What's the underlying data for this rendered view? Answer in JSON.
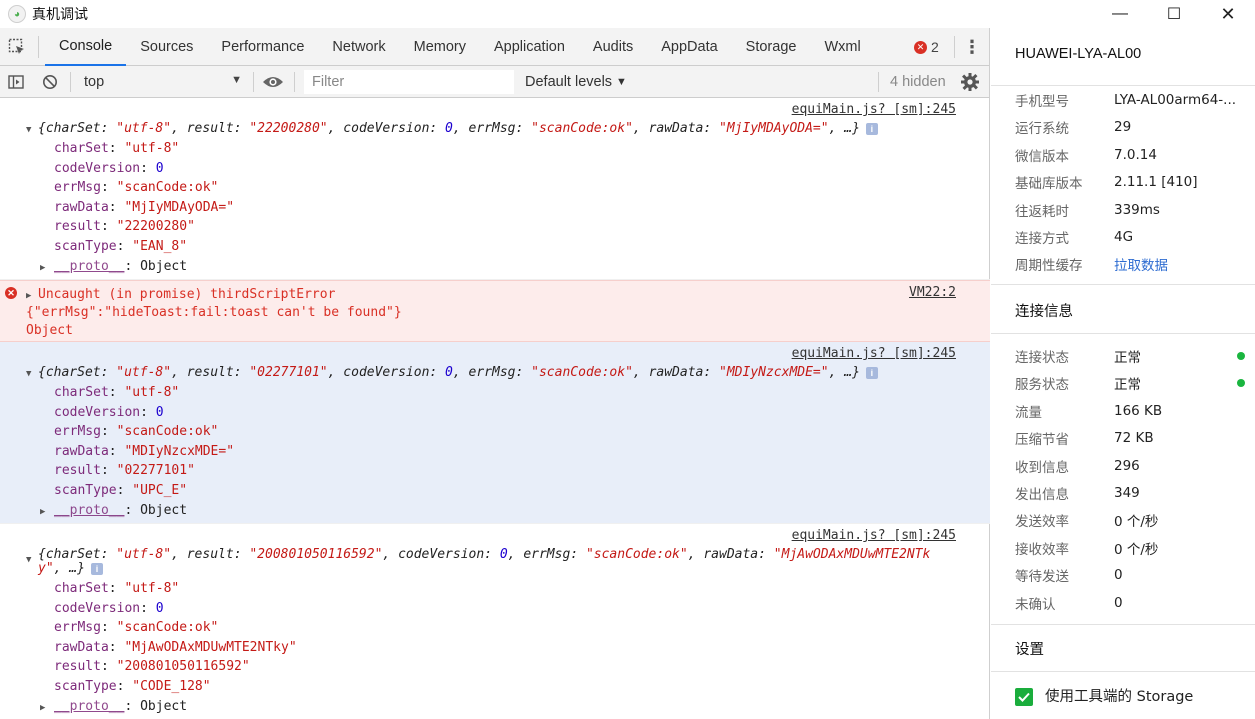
{
  "window": {
    "title": "真机调试",
    "logo_icon": "wechat-devtools-icon",
    "controls": {
      "minimize": "—",
      "maximize": "☐",
      "close": "✕"
    }
  },
  "tabs": [
    {
      "label": "Console",
      "active": true
    },
    {
      "label": "Sources"
    },
    {
      "label": "Performance"
    },
    {
      "label": "Network"
    },
    {
      "label": "Memory"
    },
    {
      "label": "Application"
    },
    {
      "label": "Audits"
    },
    {
      "label": "AppData"
    },
    {
      "label": "Storage"
    },
    {
      "label": "Wxml"
    }
  ],
  "error_count": "2",
  "filterbar": {
    "context": "top",
    "filter_placeholder": "Filter",
    "levels": "Default levels",
    "hidden": "4 hidden"
  },
  "console": {
    "entries": [
      {
        "source": "equiMain.js? [sm]:245",
        "summary_prefix": "{",
        "summary": [
          {
            "k": "charSet",
            "v": "\"utf-8\"",
            "t": "str"
          },
          {
            "k": "result",
            "v": "\"22200280\"",
            "t": "str"
          },
          {
            "k": "codeVersion",
            "v": "0",
            "t": "num"
          },
          {
            "k": "errMsg",
            "v": "\"scanCode:ok\"",
            "t": "str"
          },
          {
            "k": "rawData",
            "v": "\"MjIyMDAyODA=\"",
            "t": "str"
          }
        ],
        "summary_suffix": ", …}",
        "props": [
          {
            "k": "charSet",
            "v": "\"utf-8\"",
            "t": "str"
          },
          {
            "k": "codeVersion",
            "v": "0",
            "t": "num"
          },
          {
            "k": "errMsg",
            "v": "\"scanCode:ok\"",
            "t": "str"
          },
          {
            "k": "rawData",
            "v": "\"MjIyMDAyODA=\"",
            "t": "str"
          },
          {
            "k": "result",
            "v": "\"22200280\"",
            "t": "str"
          },
          {
            "k": "scanType",
            "v": "\"EAN_8\"",
            "t": "str"
          }
        ],
        "proto": "__proto__",
        "proto_value": "Object"
      },
      {
        "source": "VM22:2",
        "error_line1": "Uncaught (in promise) thirdScriptError",
        "error_line2": "{\"errMsg\":\"hideToast:fail:toast can't be found\"}",
        "error_line3": "Object"
      },
      {
        "source": "equiMain.js? [sm]:245",
        "summary_prefix": "{",
        "summary": [
          {
            "k": "charSet",
            "v": "\"utf-8\"",
            "t": "str"
          },
          {
            "k": "result",
            "v": "\"02277101\"",
            "t": "str"
          },
          {
            "k": "codeVersion",
            "v": "0",
            "t": "num"
          },
          {
            "k": "errMsg",
            "v": "\"scanCode:ok\"",
            "t": "str"
          },
          {
            "k": "rawData",
            "v": "\"MDIyNzcxMDE=\"",
            "t": "str"
          }
        ],
        "summary_suffix": ", …}",
        "props": [
          {
            "k": "charSet",
            "v": "\"utf-8\"",
            "t": "str"
          },
          {
            "k": "codeVersion",
            "v": "0",
            "t": "num"
          },
          {
            "k": "errMsg",
            "v": "\"scanCode:ok\"",
            "t": "str"
          },
          {
            "k": "rawData",
            "v": "\"MDIyNzcxMDE=\"",
            "t": "str"
          },
          {
            "k": "result",
            "v": "\"02277101\"",
            "t": "str"
          },
          {
            "k": "scanType",
            "v": "\"UPC_E\"",
            "t": "str"
          }
        ],
        "proto": "__proto__",
        "proto_value": "Object"
      },
      {
        "source": "equiMain.js? [sm]:245",
        "summary_prefix": "{",
        "summary": [
          {
            "k": "charSet",
            "v": "\"utf-8\"",
            "t": "str"
          },
          {
            "k": "result",
            "v": "\"200801050116592\"",
            "t": "str"
          },
          {
            "k": "codeVersion",
            "v": "0",
            "t": "num"
          },
          {
            "k": "errMsg",
            "v": "\"scanCode:ok\"",
            "t": "str"
          },
          {
            "k": "rawData",
            "v": "\"MjAwODAxMDUwMTE2NTk",
            "t": "str"
          }
        ],
        "summary_wrap": "y\"",
        "summary_suffix": ", …}",
        "props": [
          {
            "k": "charSet",
            "v": "\"utf-8\"",
            "t": "str"
          },
          {
            "k": "codeVersion",
            "v": "0",
            "t": "num"
          },
          {
            "k": "errMsg",
            "v": "\"scanCode:ok\"",
            "t": "str"
          },
          {
            "k": "rawData",
            "v": "\"MjAwODAxMDUwMTE2NTky\"",
            "t": "str"
          },
          {
            "k": "result",
            "v": "\"200801050116592\"",
            "t": "str"
          },
          {
            "k": "scanType",
            "v": "\"CODE_128\"",
            "t": "str"
          }
        ],
        "proto": "__proto__",
        "proto_value": "Object"
      }
    ]
  },
  "device": {
    "name": "HUAWEI-LYA-AL00",
    "basic": [
      {
        "label": "手机型号",
        "value": "LYA-AL00arm64-..."
      },
      {
        "label": "运行系统",
        "value": "29"
      },
      {
        "label": "微信版本",
        "value": "7.0.14"
      },
      {
        "label": "基础库版本",
        "value": "2.11.1 [410]"
      },
      {
        "label": "往返耗时",
        "value": "339ms"
      },
      {
        "label": "连接方式",
        "value": "4G"
      },
      {
        "label": "周期性缓存",
        "value": "拉取数据",
        "link": true
      }
    ],
    "connection_title": "连接信息",
    "connection": [
      {
        "label": "连接状态",
        "value": "正常",
        "dot": true
      },
      {
        "label": "服务状态",
        "value": "正常",
        "dot": true
      },
      {
        "label": "流量",
        "value": "166 KB"
      },
      {
        "label": "压缩节省",
        "value": "72 KB"
      },
      {
        "label": "收到信息",
        "value": "296"
      },
      {
        "label": "发出信息",
        "value": "349"
      },
      {
        "label": "发送效率",
        "value": "0 个/秒"
      },
      {
        "label": "接收效率",
        "value": "0 个/秒"
      },
      {
        "label": "等待发送",
        "value": "0"
      },
      {
        "label": "未确认",
        "value": "0"
      }
    ],
    "settings_title": "设置",
    "storage_option": "使用工具端的 Storage",
    "storage_checked": true,
    "status_color": "#1ab53f"
  }
}
